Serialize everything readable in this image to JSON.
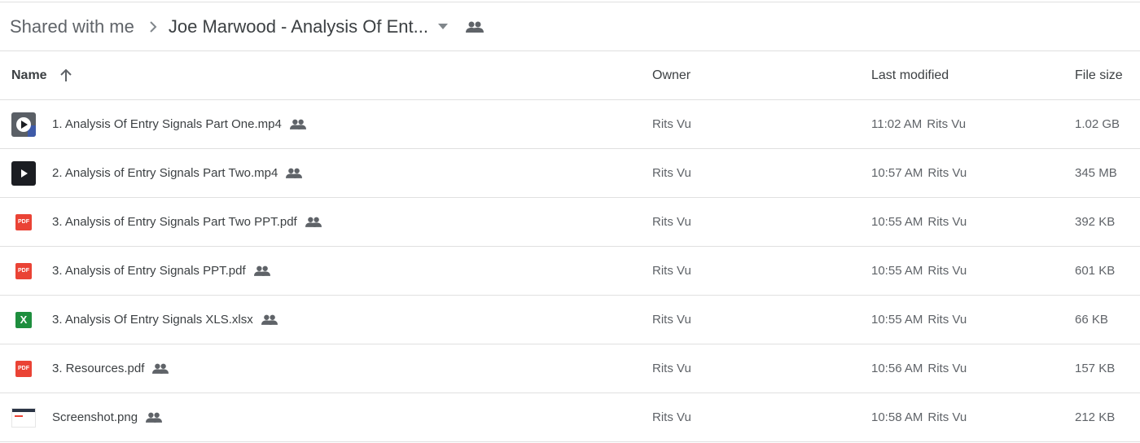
{
  "breadcrumb": {
    "root": "Shared with me",
    "current": "Joe Marwood - Analysis Of Ent..."
  },
  "columns": {
    "name": "Name",
    "owner": "Owner",
    "last_modified": "Last modified",
    "file_size": "File size"
  },
  "files": [
    {
      "name": "1. Analysis Of Entry Signals Part One.mp4",
      "type": "video",
      "owner": "Rits Vu",
      "modified_time": "11:02 AM",
      "modified_by": "Rits Vu",
      "size": "1.02 GB"
    },
    {
      "name": "2. Analysis of Entry Signals Part Two.mp4",
      "type": "video",
      "owner": "Rits Vu",
      "modified_time": "10:57 AM",
      "modified_by": "Rits Vu",
      "size": "345 MB"
    },
    {
      "name": "3. Analysis of Entry Signals Part Two PPT.pdf",
      "type": "pdf",
      "owner": "Rits Vu",
      "modified_time": "10:55 AM",
      "modified_by": "Rits Vu",
      "size": "392 KB"
    },
    {
      "name": "3. Analysis of Entry Signals PPT.pdf",
      "type": "pdf",
      "owner": "Rits Vu",
      "modified_time": "10:55 AM",
      "modified_by": "Rits Vu",
      "size": "601 KB"
    },
    {
      "name": "3. Analysis Of Entry Signals XLS.xlsx",
      "type": "xlsx",
      "owner": "Rits Vu",
      "modified_time": "10:55 AM",
      "modified_by": "Rits Vu",
      "size": "66 KB"
    },
    {
      "name": "3. Resources.pdf",
      "type": "pdf",
      "owner": "Rits Vu",
      "modified_time": "10:56 AM",
      "modified_by": "Rits Vu",
      "size": "157 KB"
    },
    {
      "name": "Screenshot.png",
      "type": "image",
      "owner": "Rits Vu",
      "modified_time": "10:58 AM",
      "modified_by": "Rits Vu",
      "size": "212 KB"
    }
  ],
  "badges": {
    "pdf": "PDF",
    "xlsx": "X"
  },
  "colors": {
    "pdf": "#ea4335",
    "xlsx": "#1e8e3e",
    "text": "#3c4043",
    "muted": "#5f6368",
    "divider": "#e0e0e0"
  },
  "icons": {
    "separator": "chevron-right-icon",
    "dropdown": "caret-down-icon",
    "shared": "people-icon",
    "sort": "arrow-up-icon"
  }
}
